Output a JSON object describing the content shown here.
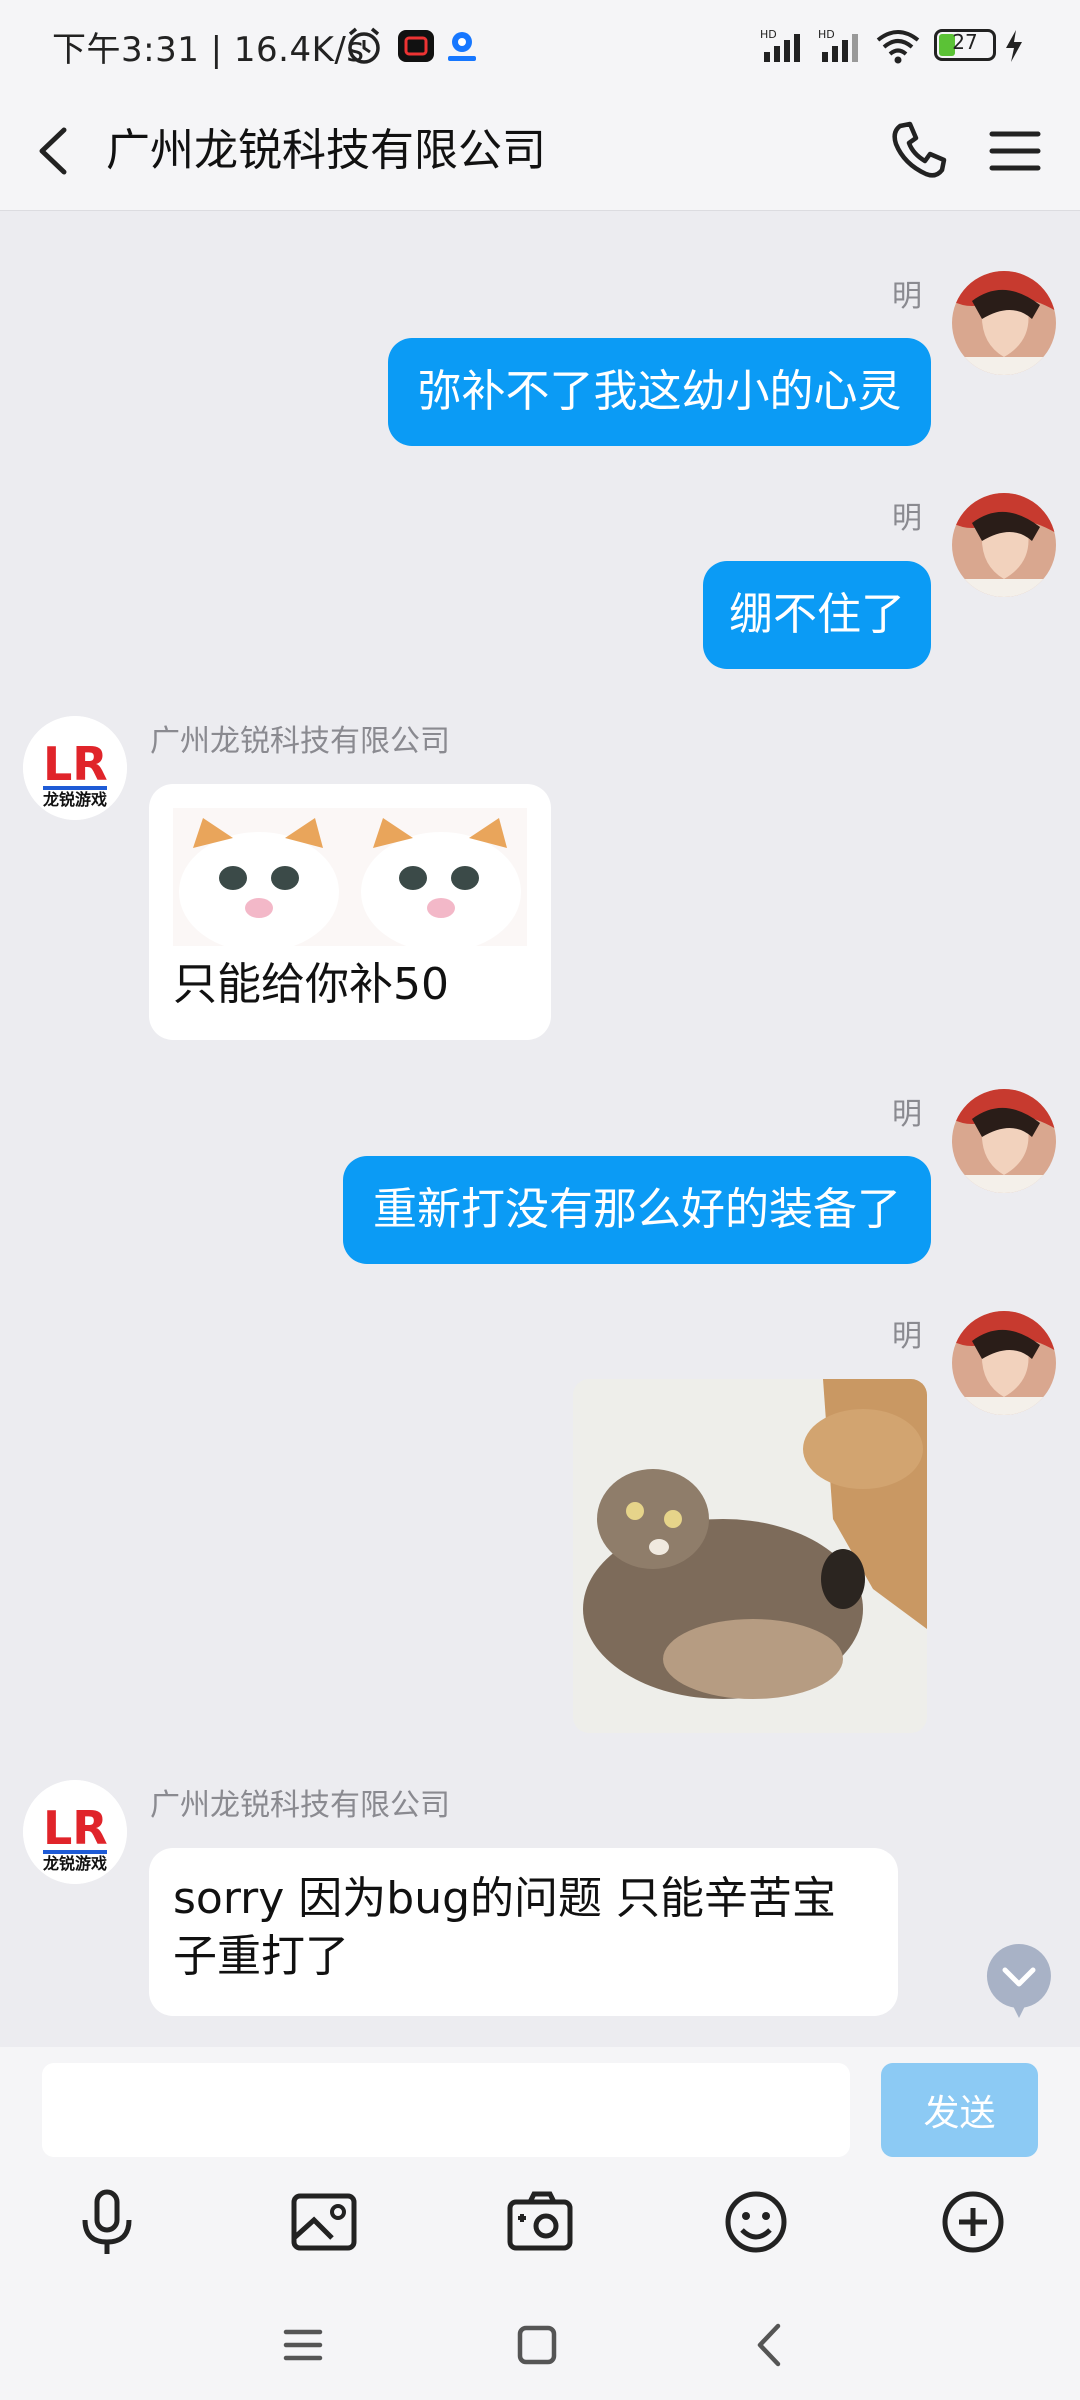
{
  "status_bar": {
    "text": "下午3:31 | 16.4K/s",
    "battery": "27"
  },
  "header": {
    "title": "广州龙锐科技有限公司"
  },
  "messages": [
    {
      "sender": "明",
      "text": "弥补不了我这幼小的心灵"
    },
    {
      "sender": "明",
      "text": "绷不住了"
    },
    {
      "sender": "广州龙锐科技有限公司",
      "text": "只能给你补50"
    },
    {
      "sender": "明",
      "text": "重新打没有那么好的装备了"
    },
    {
      "sender": "明",
      "text": ""
    },
    {
      "sender": "广州龙锐科技有限公司",
      "text": "sorry 因为bug的问题 只能辛苦宝子重打了"
    }
  ],
  "brand": {
    "logo_text": "LR",
    "logo_sub": "龙锐游戏"
  },
  "input": {
    "placeholder": "",
    "send_label": "发送"
  },
  "colors": {
    "my_bubble": "#0b9bf5",
    "their_bubble": "#ffffff",
    "background": "#ececf0",
    "send_disabled": "#8ccaf4"
  }
}
